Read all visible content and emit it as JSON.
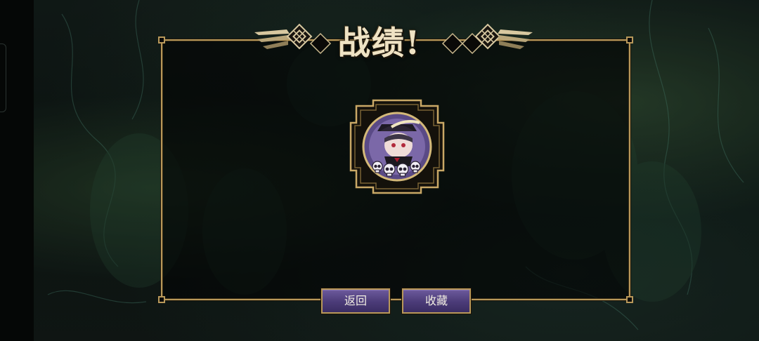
{
  "title": "战绩!",
  "buttons": {
    "back_label": "返回",
    "favorite_label": "收藏"
  },
  "emblem": {
    "icon": "vampire-character-portrait",
    "skull_count": 4
  },
  "colors": {
    "frame_gold": "#b8985a",
    "button_purple": "#4b3b78",
    "emblem_purple": "#6d5a9c",
    "title_cream": "#efe3c4"
  }
}
